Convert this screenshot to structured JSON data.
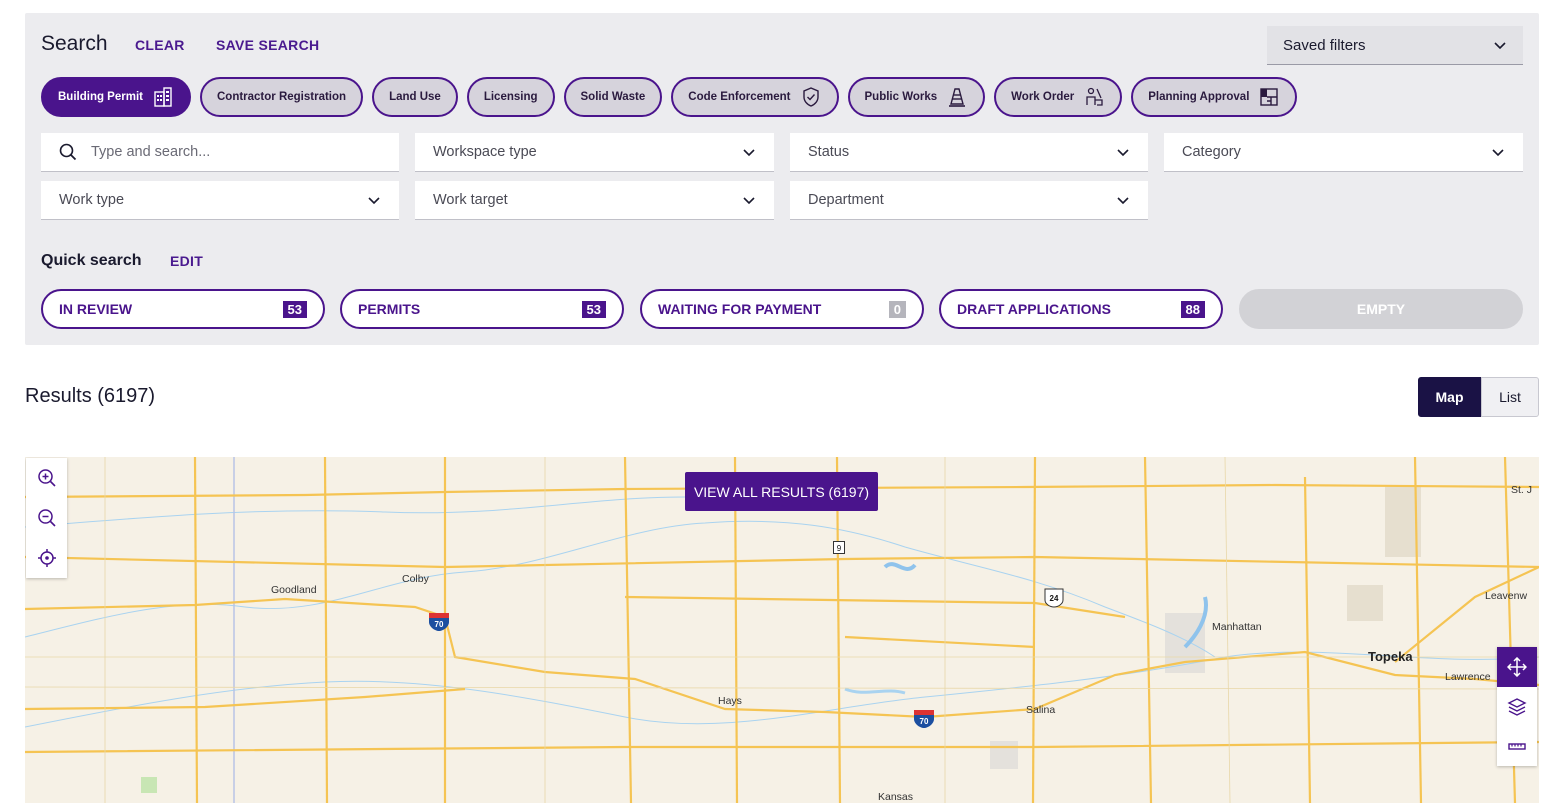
{
  "search": {
    "title": "Search",
    "clear_label": "CLEAR",
    "save_label": "SAVE SEARCH",
    "saved_filters": "Saved filters"
  },
  "chips": [
    {
      "label": "Building Permit",
      "icon": "building-icon",
      "active": true
    },
    {
      "label": "Contractor Registration",
      "icon": null,
      "active": false
    },
    {
      "label": "Land Use",
      "icon": null,
      "active": false
    },
    {
      "label": "Licensing",
      "icon": null,
      "active": false
    },
    {
      "label": "Solid Waste",
      "icon": null,
      "active": false
    },
    {
      "label": "Code Enforcement",
      "icon": "shield-check-icon",
      "active": false
    },
    {
      "label": "Public Works",
      "icon": "traffic-cone-icon",
      "active": false
    },
    {
      "label": "Work Order",
      "icon": "worker-icon",
      "active": false
    },
    {
      "label": "Planning Approval",
      "icon": "blueprint-icon",
      "active": false
    }
  ],
  "filters": {
    "search_placeholder": "Type and search...",
    "workspace_type": "Workspace type",
    "status": "Status",
    "category": "Category",
    "work_type": "Work type",
    "work_target": "Work target",
    "department": "Department"
  },
  "quick_search": {
    "title": "Quick search",
    "edit_label": "EDIT",
    "items": [
      {
        "label": "IN REVIEW",
        "count": "53"
      },
      {
        "label": "PERMITS",
        "count": "53"
      },
      {
        "label": "WAITING FOR PAYMENT",
        "count": "0"
      },
      {
        "label": "DRAFT APPLICATIONS",
        "count": "88"
      },
      {
        "label": "EMPTY",
        "count": null
      }
    ]
  },
  "results": {
    "title": "Results (6197)",
    "map_label": "Map",
    "list_label": "List"
  },
  "map": {
    "view_all_label": "VIEW ALL RESULTS (6197)",
    "places": [
      "Goodland",
      "Colby",
      "Hays",
      "Salina",
      "Manhattan",
      "Topeka",
      "Lawrence",
      "Leavenw",
      "St. J",
      "Kansas"
    ],
    "shields": [
      "70",
      "70",
      "9",
      "24"
    ]
  },
  "colors": {
    "accent": "#4a148c",
    "dark": "#1a1245",
    "panel": "#ececef",
    "map_bg": "#f6f1e6",
    "road": "#f5c453"
  }
}
